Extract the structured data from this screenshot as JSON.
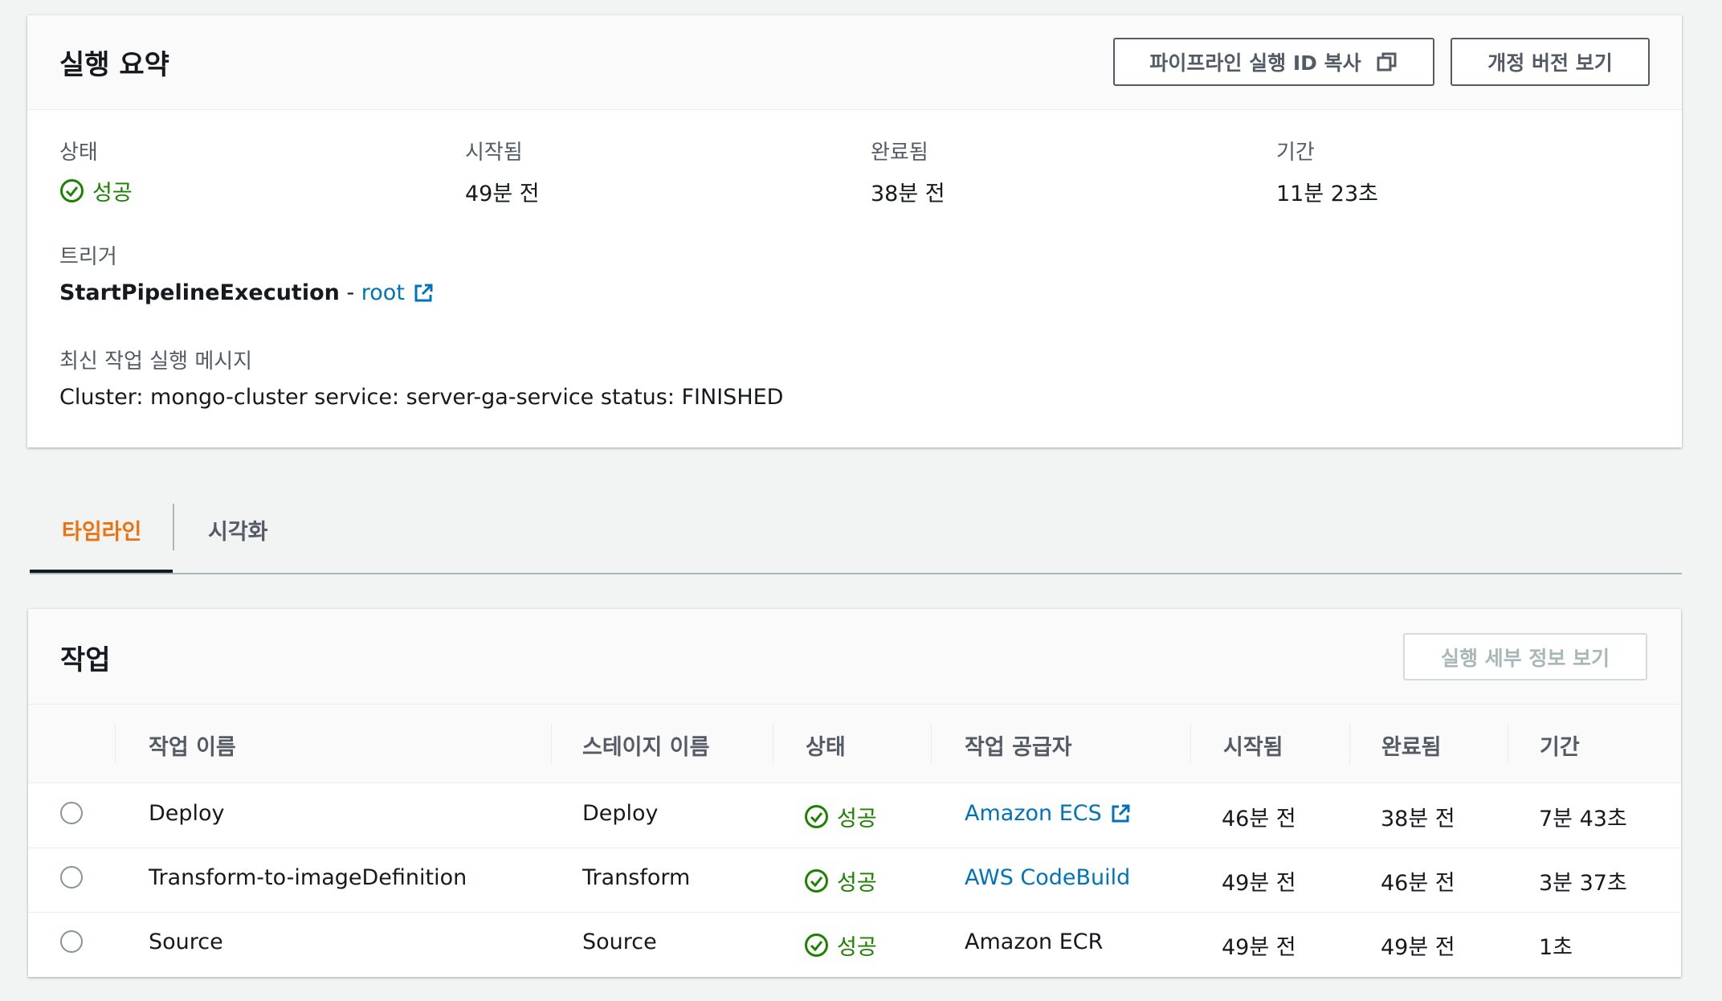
{
  "summary": {
    "title": "실행 요약",
    "copy_button": "파이프라인 실행 ID 복사",
    "revisions_button": "개정 버전 보기",
    "status_label": "상태",
    "status_value": "성공",
    "started_label": "시작됨",
    "started_value": "49분 전",
    "completed_label": "완료됨",
    "completed_value": "38분 전",
    "duration_label": "기간",
    "duration_value": "11분 23초",
    "trigger_label": "트리거",
    "trigger_type": "StartPipelineExecution",
    "trigger_separator": " - ",
    "trigger_user": "root",
    "message_label": "최신 작업 실행 메시지",
    "message_value": "Cluster: mongo-cluster service: server-ga-service status: FINISHED"
  },
  "tabs": [
    {
      "label": "타임라인",
      "active": true
    },
    {
      "label": "시각화",
      "active": false
    }
  ],
  "actions": {
    "title": "작업",
    "details_button": "실행 세부 정보 보기",
    "columns": [
      "작업 이름",
      "스테이지 이름",
      "상태",
      "작업 공급자",
      "시작됨",
      "완료됨",
      "기간"
    ],
    "rows": [
      {
        "name": "Deploy",
        "stage": "Deploy",
        "status": "성공",
        "provider": "Amazon ECS",
        "provider_link": true,
        "provider_external": true,
        "started": "46분 전",
        "completed": "38분 전",
        "duration": "7분 43초"
      },
      {
        "name": "Transform-to-imageDefinition",
        "stage": "Transform",
        "status": "성공",
        "provider": "AWS CodeBuild",
        "provider_link": true,
        "provider_external": false,
        "started": "49분 전",
        "completed": "46분 전",
        "duration": "3분 37초"
      },
      {
        "name": "Source",
        "stage": "Source",
        "status": "성공",
        "provider": "Amazon ECR",
        "provider_link": false,
        "provider_external": false,
        "started": "49분 전",
        "completed": "49분 전",
        "duration": "1초"
      }
    ]
  },
  "colors": {
    "success": "#1d8102",
    "link": "#0073bb",
    "tab_active": "#ec7211",
    "background": "#f2f3f3"
  },
  "icons": {
    "status_success": "check-circle-icon",
    "external_link": "external-link-icon",
    "copy": "copy-icon"
  }
}
